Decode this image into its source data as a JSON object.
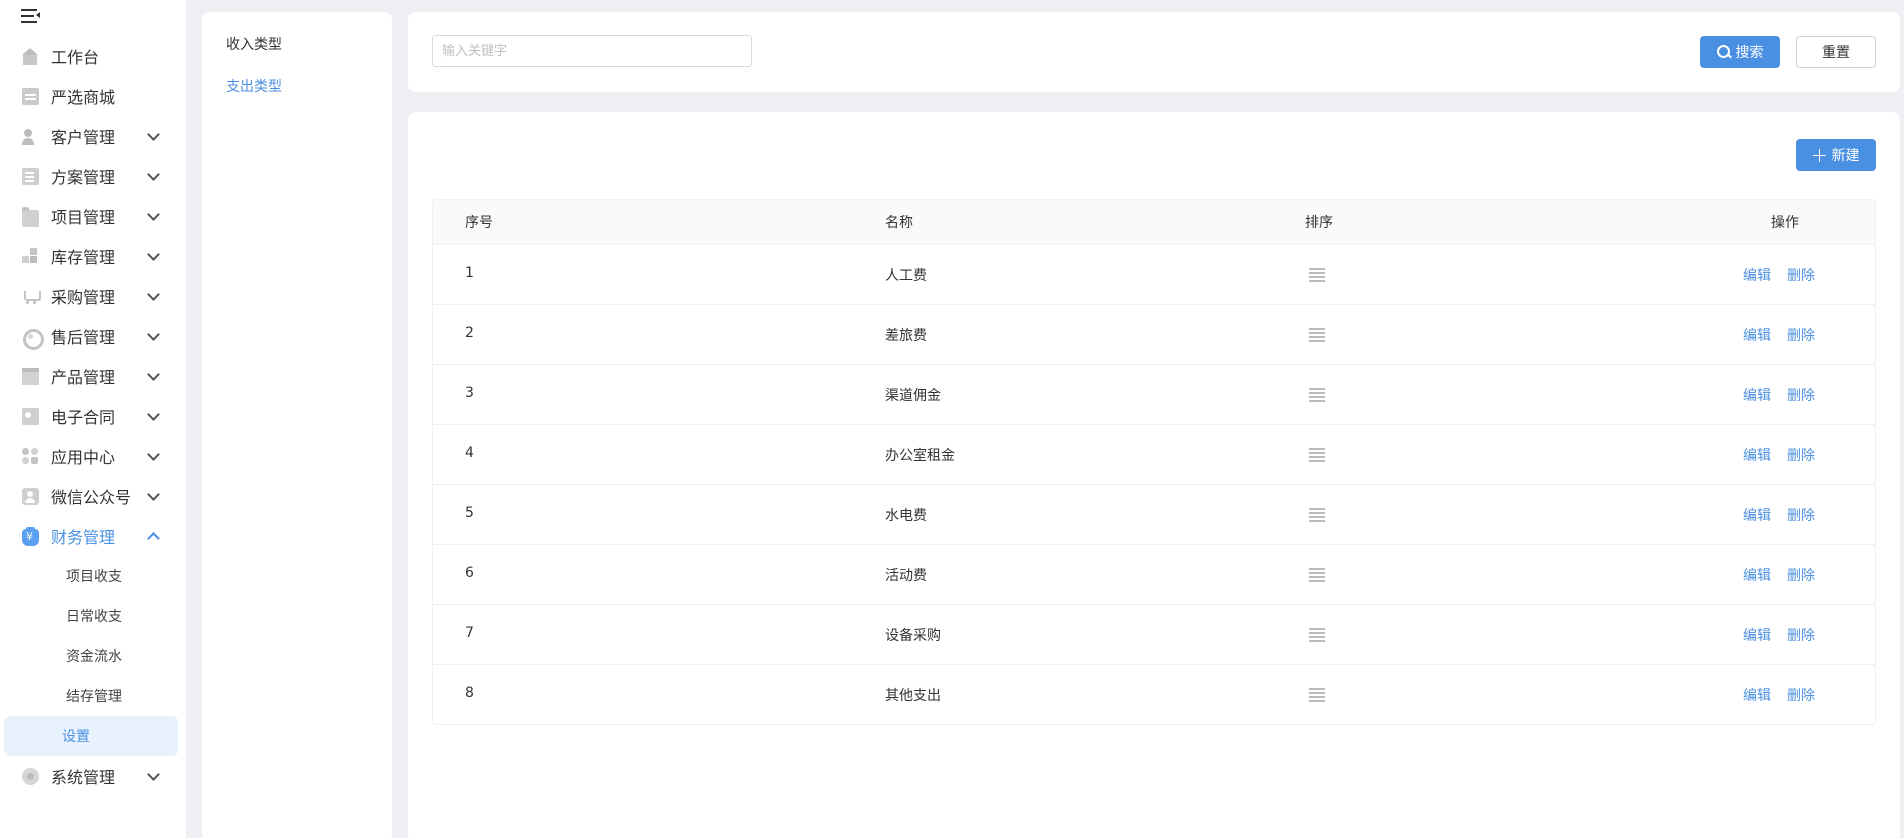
{
  "sidebar": {
    "items": [
      {
        "label": "工作台",
        "icon": "home-icon",
        "expandable": false
      },
      {
        "label": "严选商城",
        "icon": "store-icon",
        "expandable": false
      },
      {
        "label": "客户管理",
        "icon": "customer-icon",
        "expandable": true
      },
      {
        "label": "方案管理",
        "icon": "document-icon",
        "expandable": true
      },
      {
        "label": "项目管理",
        "icon": "folder-icon",
        "expandable": true
      },
      {
        "label": "库存管理",
        "icon": "inventory-icon",
        "expandable": true
      },
      {
        "label": "采购管理",
        "icon": "cart-icon",
        "expandable": true
      },
      {
        "label": "售后管理",
        "icon": "headset-icon",
        "expandable": true
      },
      {
        "label": "产品管理",
        "icon": "product-icon",
        "expandable": true
      },
      {
        "label": "电子合同",
        "icon": "contract-icon",
        "expandable": true
      },
      {
        "label": "应用中心",
        "icon": "apps-icon",
        "expandable": true
      },
      {
        "label": "微信公众号",
        "icon": "wechat-icon",
        "expandable": true
      },
      {
        "label": "财务管理",
        "icon": "finance-icon",
        "expandable": true,
        "open": true
      }
    ],
    "finance_submenu": [
      "项目收支",
      "日常收支",
      "资金流水",
      "结存管理",
      "设置"
    ],
    "active_submenu": "设置",
    "system": {
      "label": "系统管理",
      "icon": "settings-icon"
    }
  },
  "categories": {
    "income": "收入类型",
    "expense": "支出类型",
    "active": "expense"
  },
  "search": {
    "placeholder": "输入关键字",
    "value": "",
    "search_label": "搜索",
    "reset_label": "重置"
  },
  "toolbar": {
    "new_label": "新建"
  },
  "table": {
    "columns": {
      "no": "序号",
      "name": "名称",
      "sort": "排序",
      "op": "操作"
    },
    "edit_label": "编辑",
    "delete_label": "删除",
    "rows": [
      {
        "no": "1",
        "name": "人工费"
      },
      {
        "no": "2",
        "name": "差旅费"
      },
      {
        "no": "3",
        "name": "渠道佣金"
      },
      {
        "no": "4",
        "name": "办公室租金"
      },
      {
        "no": "5",
        "name": "水电费"
      },
      {
        "no": "6",
        "name": "活动费"
      },
      {
        "no": "7",
        "name": "设备采购"
      },
      {
        "no": "8",
        "name": "其他支出"
      }
    ]
  },
  "colors": {
    "accent": "#4a90e2",
    "active_bg": "#e8f2fd",
    "page_bg": "#eef0f4"
  }
}
